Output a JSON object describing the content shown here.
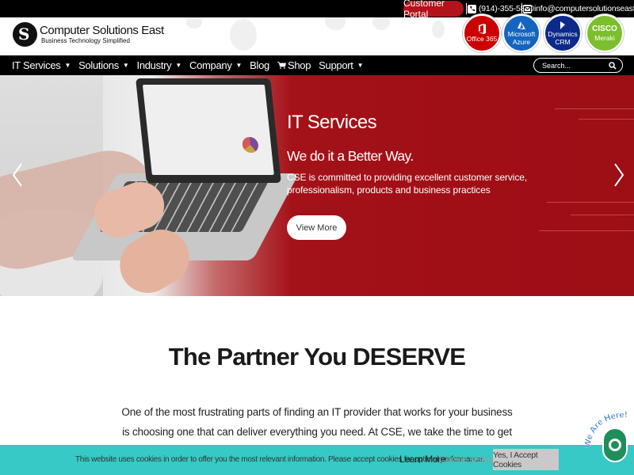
{
  "topbar": {
    "portal_label": "Customer Portal",
    "phone": "(914)-355-5800",
    "email": "info@computersolutionseast.com"
  },
  "header": {
    "logo_mark": "S",
    "brand_name": "Computer Solutions East",
    "tagline": "Business Technology Simplified",
    "badges": [
      {
        "line1": "Office 365",
        "line2": "",
        "icon": "office-icon",
        "color": "#cc0000"
      },
      {
        "line1": "Microsoft",
        "line2": "Azure",
        "icon": "azure-icon",
        "color": "#1565c0"
      },
      {
        "line1": "Dynamics",
        "line2": "CRM",
        "icon": "dynamics-icon",
        "color": "#0d2a8a"
      },
      {
        "line1": "CISCO",
        "line2": "Meraki",
        "icon": "cisco-icon",
        "color": "#7cbf2e"
      }
    ]
  },
  "nav": {
    "items": [
      {
        "label": "IT Services",
        "dropdown": true
      },
      {
        "label": "Solutions",
        "dropdown": true
      },
      {
        "label": "Industry",
        "dropdown": true
      },
      {
        "label": "Company",
        "dropdown": true
      },
      {
        "label": "Blog",
        "dropdown": false
      },
      {
        "label": "Shop",
        "dropdown": false
      },
      {
        "label": "Support",
        "dropdown": true
      }
    ],
    "search_placeholder": "Search..."
  },
  "hero": {
    "title": "IT Services",
    "subtitle": "We do it a Better Way.",
    "description": "CSE is committed to providing excellent customer service, professionalism, products and business practices",
    "button_label": "View More",
    "accent_color": "#a41219"
  },
  "partner": {
    "title": "The Partner You DESERVE",
    "text": "One of the most frustrating parts of finding an IT provider that works for your business is choosing one that can deliver everything you need. At CSE, we take the time to get to know"
  },
  "cookie": {
    "text": "This website uses cookies in order to offer you the most relevant information. Please accept cookies for optimal performance.",
    "learn_more": "Learn More",
    "settings": "Cookie settings",
    "accept": "Yes, I Accept Cookies",
    "bar_color": "#36c9c5"
  },
  "chat": {
    "label": "We Are Here!"
  }
}
